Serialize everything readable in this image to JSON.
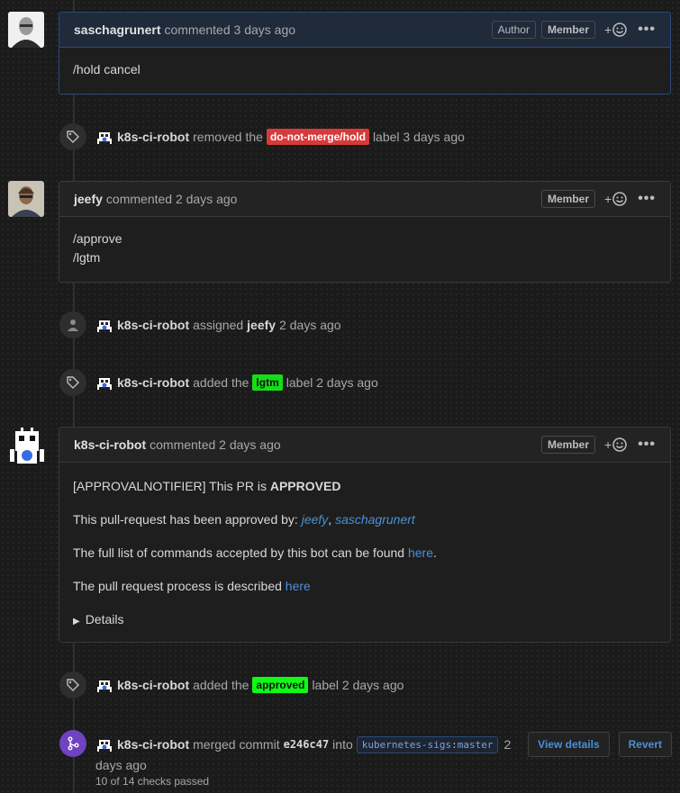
{
  "colors": {
    "label_hold_bg": "#d73a3a",
    "label_lgtm_bg": "#15dd18",
    "label_approved_bg": "#0ffa16",
    "link": "#4a90d9",
    "merge_badge": "#6f42c1"
  },
  "comment1": {
    "author": "saschagrunert",
    "meta": "commented 3 days ago",
    "role_author": "Author",
    "role_member": "Member",
    "react": "+",
    "dots": "•••",
    "body": "/hold cancel"
  },
  "event1": {
    "actor": "k8s-ci-robot",
    "text_before": "removed the",
    "label": "do-not-merge/hold",
    "text_after": "label 3 days ago"
  },
  "comment2": {
    "author": "jeefy",
    "meta": "commented 2 days ago",
    "role_member": "Member",
    "react": "+",
    "dots": "•••",
    "line1": "/approve",
    "line2": "/lgtm"
  },
  "event2": {
    "actor": "k8s-ci-robot",
    "text_before": "assigned",
    "assignee": "jeefy",
    "text_after": "2 days ago"
  },
  "event3": {
    "actor": "k8s-ci-robot",
    "text_before": "added the",
    "label": "lgtm",
    "text_after": "label 2 days ago"
  },
  "comment3": {
    "author": "k8s-ci-robot",
    "meta": "commented 2 days ago",
    "role_member": "Member",
    "react": "+",
    "dots": "•••",
    "p1_text": "[APPROVALNOTIFIER] This PR is ",
    "p1_bold": "APPROVED",
    "p2_text": "This pull-request has been approved by: ",
    "p2_user1": "jeefy",
    "p2_sep": ", ",
    "p2_user2": "saschagrunert",
    "p3_text": "The full list of commands accepted by this bot can be found ",
    "p3_link": "here",
    "p3_end": ".",
    "p4_text": "The pull request process is described ",
    "p4_link": "here",
    "details": "Details"
  },
  "event4": {
    "actor": "k8s-ci-robot",
    "text_before": "added the",
    "label": "approved",
    "text_after": "label 2 days ago"
  },
  "event5": {
    "actor": "k8s-ci-robot",
    "text_before": "merged commit",
    "commit": "e246c47",
    "into": "into",
    "ref_org": "kubernetes-sigs",
    "ref_sep": ":",
    "ref_branch": "master",
    "time_a": "2",
    "time_b": "days ago",
    "view_details": "View details",
    "revert": "Revert",
    "checks": "10 of 14 checks passed"
  }
}
